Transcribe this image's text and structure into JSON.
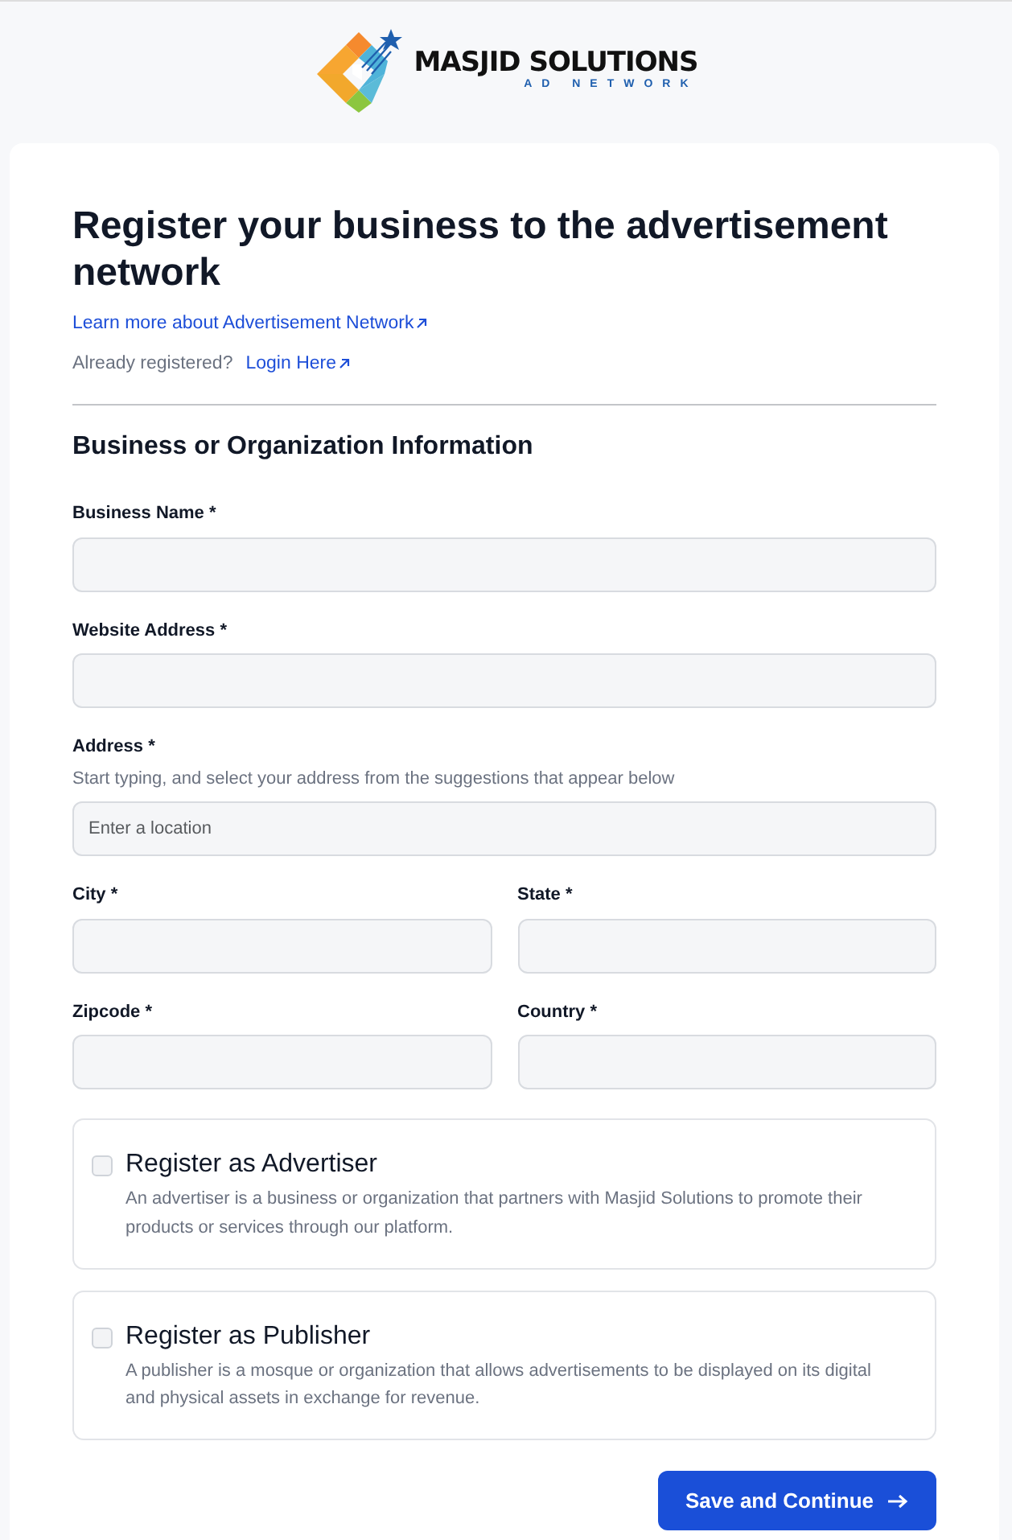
{
  "logo": {
    "name": "MASJID SOLUTIONS",
    "tagline": "AD NETWORK"
  },
  "heading": "Register your business to the advertisement network",
  "learn_more_link": "Learn more about Advertisement Network",
  "login_prompt": "Already registered?",
  "login_link": "Login Here",
  "section_title": "Business or Organization Information",
  "fields": [
    {
      "kind": "full",
      "label": "Business Name *"
    },
    {
      "kind": "full",
      "label": "Website Address *"
    },
    {
      "kind": "full",
      "label": "Address *",
      "hint": "Start typing, and select your address from the suggestions that appear below",
      "placeholder": "Enter a location"
    },
    {
      "kind": "half",
      "label": "City *"
    },
    {
      "kind": "half",
      "label": "State *"
    },
    {
      "kind": "half",
      "label": "Zipcode *"
    },
    {
      "kind": "half",
      "label": "Country *"
    }
  ],
  "options": [
    {
      "title": "Register as Advertiser",
      "description": "An advertiser is a business or organization that partners with Masjid Solutions to promote their products or services through our platform.",
      "checked": false
    },
    {
      "title": "Register as Publisher",
      "description": "A publisher is a mosque or organization that allows advertisements to be displayed on its digital and physical assets in exchange for revenue.",
      "checked": false
    }
  ],
  "submit_button": "Save and Continue"
}
